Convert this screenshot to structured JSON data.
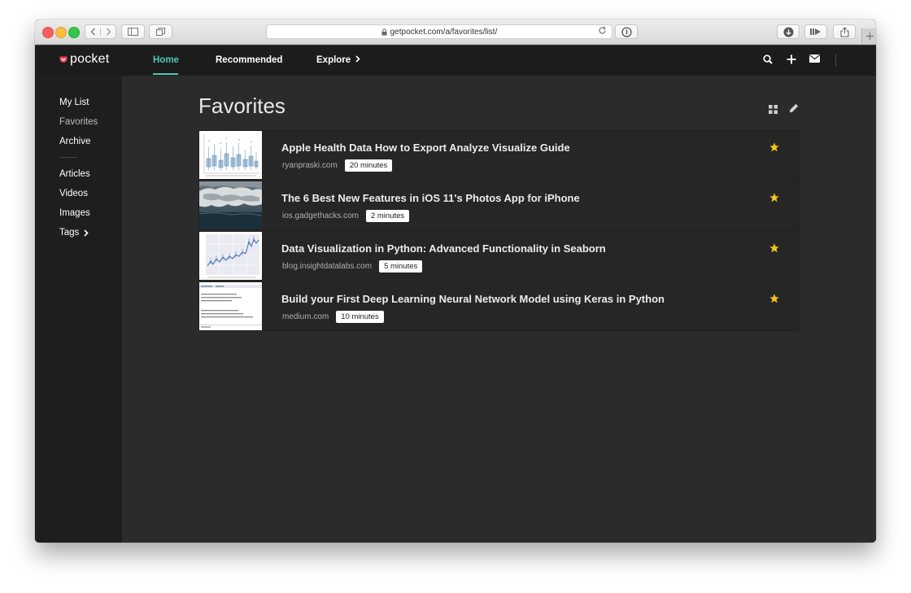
{
  "browser": {
    "url": "getpocket.com/a/favorites/list/"
  },
  "header": {
    "logo": "pocket",
    "nav": {
      "home": "Home",
      "recommended": "Recommended",
      "explore": "Explore"
    },
    "accent_color": "#4fc6b7"
  },
  "sidebar": {
    "items": [
      {
        "label": "My List"
      },
      {
        "label": "Favorites"
      },
      {
        "label": "Archive"
      },
      {
        "label": "Articles"
      },
      {
        "label": "Videos"
      },
      {
        "label": "Images"
      },
      {
        "label": "Tags"
      }
    ]
  },
  "main": {
    "title": "Favorites",
    "items": [
      {
        "title": "Apple Health Data How to Export Analyze Visualize Guide",
        "domain": "ryanpraski.com",
        "read_time": "20 minutes"
      },
      {
        "title": "The 6 Best New Features in iOS 11's Photos App for iPhone",
        "domain": "ios.gadgethacks.com",
        "read_time": "2 minutes"
      },
      {
        "title": "Data Visualization in Python: Advanced Functionality in Seaborn",
        "domain": "blog.insightdatalabs.com",
        "read_time": "5 minutes"
      },
      {
        "title": "Build your First Deep Learning Neural Network Model using Keras in Python",
        "domain": "medium.com",
        "read_time": "10 minutes"
      }
    ],
    "star_color": "#f5c518"
  }
}
